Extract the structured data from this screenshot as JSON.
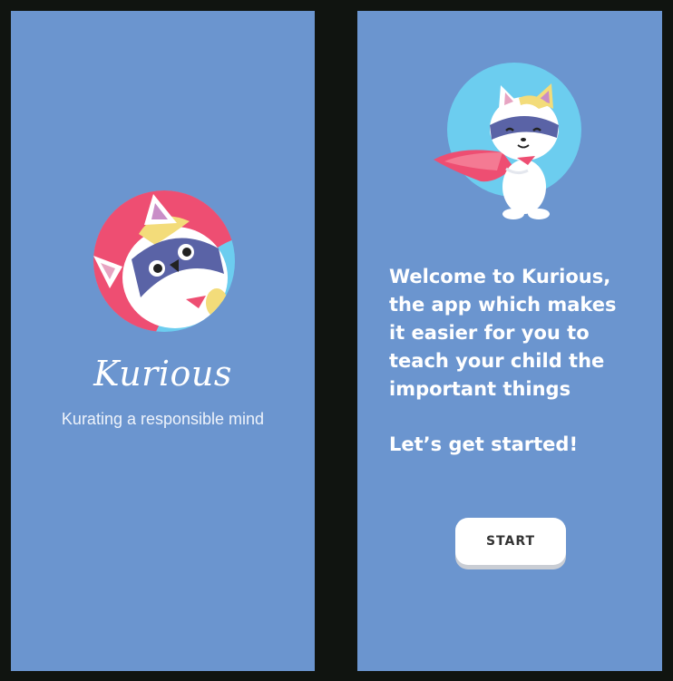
{
  "splash": {
    "brand_name": "Kurious",
    "tagline": "Kurating a responsible mind",
    "avatar_icon": "cat-mascot-icon"
  },
  "welcome": {
    "mascot_icon": "superhero-cat-icon",
    "message": "Welcome to Kurious, the app which makes it easier for you to teach your child the important things",
    "cta": "Let’s get started!",
    "start_label": "START"
  },
  "colors": {
    "background": "#101410",
    "screen": "#6b95cf",
    "button": "#ffffff",
    "button_text": "#333333",
    "circle_red": "#ee4e72",
    "circle_blue": "#6ccdef"
  }
}
